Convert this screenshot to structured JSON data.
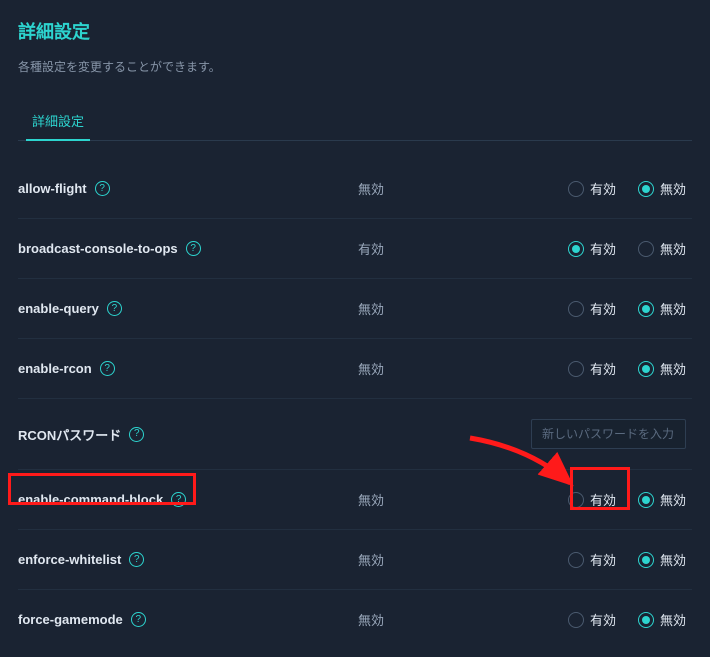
{
  "header": {
    "title": "詳細設定",
    "description": "各種設定を変更することができます。"
  },
  "tabs": [
    {
      "label": "詳細設定",
      "active": true
    }
  ],
  "radio_labels": {
    "enabled": "有効",
    "disabled": "無効"
  },
  "settings": [
    {
      "key": "allow-flight",
      "label": "allow-flight",
      "help": true,
      "type": "radio",
      "status": "無効",
      "selected": "disabled"
    },
    {
      "key": "broadcast-console-to-ops",
      "label": "broadcast-console-to-ops",
      "help": true,
      "type": "radio",
      "status": "有効",
      "selected": "enabled"
    },
    {
      "key": "enable-query",
      "label": "enable-query",
      "help": true,
      "type": "radio",
      "status": "無効",
      "selected": "disabled"
    },
    {
      "key": "enable-rcon",
      "label": "enable-rcon",
      "help": true,
      "type": "radio",
      "status": "無効",
      "selected": "disabled"
    },
    {
      "key": "rcon-password",
      "label": "RCONパスワード",
      "help": true,
      "type": "text",
      "placeholder": "新しいパスワードを入力",
      "value": ""
    },
    {
      "key": "enable-command-block",
      "label": "enable-command-block",
      "help": true,
      "type": "radio",
      "status": "無効",
      "selected": "disabled",
      "highlight_label": true,
      "highlight_enable_radio": true
    },
    {
      "key": "enforce-whitelist",
      "label": "enforce-whitelist",
      "help": true,
      "type": "radio",
      "status": "無効",
      "selected": "disabled"
    },
    {
      "key": "force-gamemode",
      "label": "force-gamemode",
      "help": true,
      "type": "radio",
      "status": "無効",
      "selected": "disabled"
    }
  ],
  "annotation": {
    "arrow_color": "#ff1a1a"
  }
}
